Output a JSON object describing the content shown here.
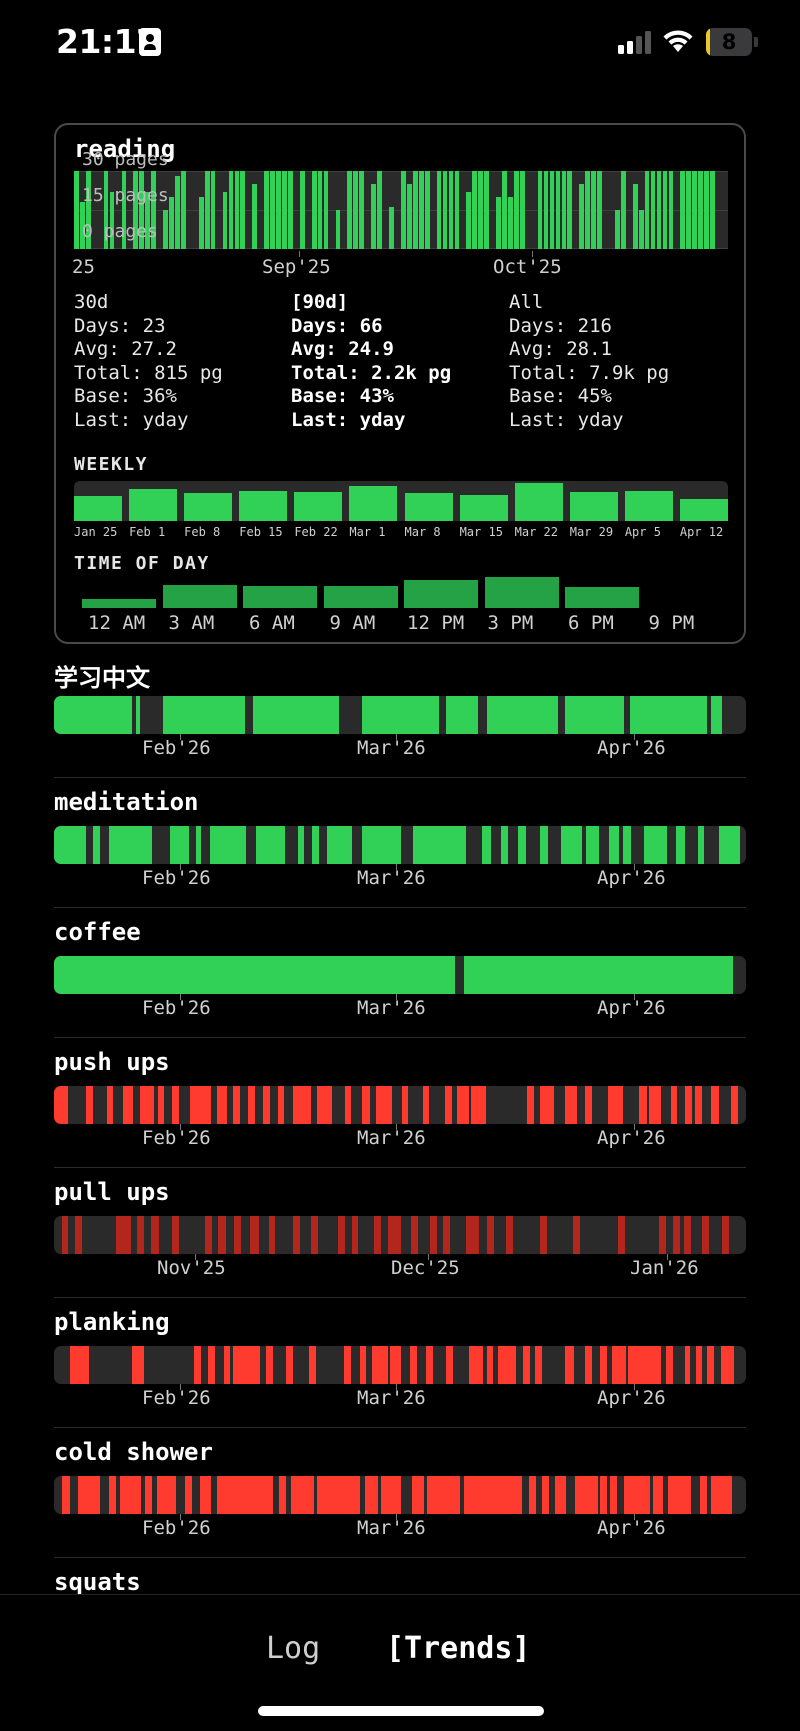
{
  "status_bar": {
    "time": "21:17",
    "battery": "8",
    "battery_level": 0.08
  },
  "reading": {
    "title": "reading",
    "y_ticks": [
      "30 pages",
      "15 pages",
      "0 pages"
    ],
    "x_ticks": [
      "25",
      "Sep'25",
      "Oct'25"
    ],
    "stats": [
      {
        "header": "30d",
        "days": "Days: 23",
        "avg": "Avg: 27.2",
        "total": "Total: 815 pg",
        "base": "Base: 36%",
        "last": "Last: yday",
        "selected": false
      },
      {
        "header": "[90d]",
        "days": "Days: 66",
        "avg": "Avg: 24.9",
        "total": "Total: 2.2k pg",
        "base": "Base: 43%",
        "last": "Last: yday",
        "selected": true
      },
      {
        "header": "All",
        "days": "Days: 216",
        "avg": "Avg: 28.1",
        "total": "Total: 7.9k pg",
        "base": "Base: 45%",
        "last": "Last: yday",
        "selected": false
      }
    ],
    "weekly_label": "WEEKLY",
    "weekly": {
      "labels": [
        "Jan 25",
        "Feb 1",
        "Feb 8",
        "Feb 15",
        "Feb 22",
        "Mar 1",
        "Mar 8",
        "Mar 15",
        "Mar 22",
        "Mar 29",
        "Apr 5",
        "Apr 12"
      ],
      "values": [
        0.62,
        0.8,
        0.7,
        0.76,
        0.72,
        0.87,
        0.7,
        0.66,
        0.95,
        0.72,
        0.75,
        0.55
      ]
    },
    "time_of_day_label": "TIME OF DAY",
    "time_of_day": {
      "labels": [
        "12 AM",
        "3 AM",
        "6 AM",
        "9 AM",
        "12 PM",
        "3 PM",
        "6 PM",
        "9 PM"
      ],
      "values": [
        0.3,
        0.75,
        0.7,
        0.72,
        0.9,
        1.0,
        0.68,
        0
      ]
    },
    "chart_data": {
      "type": "bar",
      "title": "reading",
      "ylabel_ticks": [
        "0 pages",
        "15 pages",
        "30 pages"
      ],
      "ylim": [
        0,
        30
      ],
      "x_ticks": [
        "25",
        "Sep'25",
        "Oct'25"
      ],
      "values": [
        30,
        18,
        30,
        0,
        0,
        30,
        22,
        0,
        30,
        0,
        30,
        30,
        22,
        30,
        0,
        15,
        20,
        28,
        30,
        0,
        0,
        20,
        30,
        30,
        0,
        22,
        30,
        30,
        30,
        0,
        25,
        0,
        30,
        30,
        30,
        30,
        30,
        0,
        30,
        0,
        30,
        30,
        30,
        0,
        15,
        0,
        30,
        30,
        30,
        0,
        25,
        30,
        0,
        16,
        0,
        30,
        25,
        30,
        30,
        30,
        0,
        30,
        30,
        30,
        30,
        0,
        22,
        30,
        30,
        30,
        0,
        20,
        30,
        20,
        30,
        30,
        0,
        0,
        30,
        30,
        30,
        30,
        30,
        30,
        0,
        25,
        30,
        30,
        30,
        0,
        0,
        15,
        30,
        0,
        25,
        15,
        30,
        30,
        30,
        30,
        30,
        0,
        30,
        30,
        30,
        30,
        30,
        30,
        0,
        0
      ]
    }
  },
  "habits": [
    {
      "title": "学习中文",
      "cjk": true,
      "color": "green",
      "months": [
        "Feb'26",
        "Mar'26",
        "Apr'26"
      ],
      "segments": [
        [
          0,
          11.2
        ],
        [
          11.8,
          12.4
        ],
        [
          15.7,
          25.3
        ],
        [
          22.2,
          27.6
        ],
        [
          28.8,
          41.2
        ],
        [
          44.5,
          55.7
        ],
        [
          56.7,
          61.3
        ],
        [
          62.5,
          72.8
        ],
        [
          73.8,
          82.3
        ],
        [
          83.2,
          94.3
        ],
        [
          94.9,
          96.5
        ]
      ]
    },
    {
      "title": "meditation",
      "cjk": false,
      "color": "green",
      "months": [
        "Feb'26",
        "Mar'26",
        "Apr'26"
      ],
      "segments": [
        [
          0,
          4.6
        ],
        [
          5.6,
          6.6
        ],
        [
          8.0,
          14.2
        ],
        [
          16.8,
          19.5
        ],
        [
          20.5,
          21.3
        ],
        [
          22.5,
          27.8
        ],
        [
          29.2,
          33.4
        ],
        [
          35.2,
          36.2
        ],
        [
          37.3,
          38.3
        ],
        [
          39.5,
          43.1
        ],
        [
          44.5,
          50.1
        ],
        [
          51.9,
          59.6
        ],
        [
          61.9,
          63.1
        ],
        [
          64.6,
          65.6
        ],
        [
          67.1,
          68.2
        ],
        [
          70.2,
          71.4
        ],
        [
          73.2,
          76.3
        ],
        [
          76.9,
          78.8
        ],
        [
          80.2,
          81.6
        ],
        [
          82.2,
          83.4
        ],
        [
          85.2,
          88.6
        ],
        [
          89.9,
          91.2
        ],
        [
          93.0,
          93.9
        ],
        [
          96.1,
          99.1
        ]
      ]
    },
    {
      "title": "coffee",
      "cjk": false,
      "color": "green",
      "months": [
        "Feb'26",
        "Mar'26",
        "Apr'26"
      ],
      "segments": [
        [
          0,
          58.0
        ],
        [
          59.2,
          98.1
        ]
      ]
    },
    {
      "title": "push ups",
      "cjk": false,
      "color": "red",
      "months": [
        "Feb'26",
        "Mar'26",
        "Apr'26"
      ],
      "segments": [
        [
          0,
          2.0
        ],
        [
          4.6,
          5.6
        ],
        [
          7.6,
          8.6
        ],
        [
          10.0,
          11.4
        ],
        [
          12.4,
          14.4
        ],
        [
          15.0,
          15.9
        ],
        [
          17.0,
          18.0
        ],
        [
          19.7,
          22.7
        ],
        [
          23.5,
          25.0
        ],
        [
          25.9,
          26.9
        ],
        [
          28.0,
          29.0
        ],
        [
          30.2,
          31.2
        ],
        [
          32.3,
          33.2
        ],
        [
          34.6,
          37.2
        ],
        [
          38.0,
          40.2
        ],
        [
          42.0,
          42.9
        ],
        [
          44.5,
          45.7
        ],
        [
          46.6,
          48.8
        ],
        [
          50.3,
          51.2
        ],
        [
          53.3,
          54.2
        ],
        [
          56.5,
          57.5
        ],
        [
          58.3,
          60.0
        ],
        [
          60.2,
          62.4
        ],
        [
          68.4,
          69.4
        ],
        [
          70.2,
          72.3
        ],
        [
          73.9,
          75.6
        ],
        [
          76.7,
          77.7
        ],
        [
          80.0,
          82.2
        ],
        [
          84.6,
          85.7
        ],
        [
          86.0,
          87.7
        ],
        [
          89.1,
          90.1
        ],
        [
          91.2,
          92.2
        ],
        [
          92.6,
          93.6
        ],
        [
          95.0,
          96.1
        ],
        [
          97.9,
          98.8
        ]
      ]
    },
    {
      "title": "pull ups",
      "cjk": false,
      "color": "dred",
      "months": [
        "Nov'25",
        "Dec'25",
        "Jan'26"
      ],
      "segments": [
        [
          1.1,
          2.0
        ],
        [
          3.0,
          4.0
        ],
        [
          9.0,
          11.2
        ],
        [
          12.0,
          13.0
        ],
        [
          14.0,
          15.2
        ],
        [
          17.0,
          18.0
        ],
        [
          21.8,
          22.8
        ],
        [
          23.7,
          24.9
        ],
        [
          26.0,
          27.0
        ],
        [
          28.3,
          29.6
        ],
        [
          31.0,
          32.0
        ],
        [
          34.5,
          35.5
        ],
        [
          37.2,
          38.2
        ],
        [
          41.0,
          42.0
        ],
        [
          43.0,
          44.0
        ],
        [
          46.2,
          47.2
        ],
        [
          48.2,
          50.2
        ],
        [
          51.6,
          52.6
        ],
        [
          54.3,
          55.3
        ],
        [
          56.2,
          57.2
        ],
        [
          59.6,
          61.4
        ],
        [
          62.6,
          63.6
        ],
        [
          65.3,
          66.3
        ],
        [
          70.2,
          71.2
        ],
        [
          75.0,
          76.0
        ],
        [
          81.5,
          82.5
        ],
        [
          87.4,
          88.4
        ],
        [
          89.5,
          90.5
        ],
        [
          91.1,
          92.1
        ],
        [
          93.7,
          94.7
        ],
        [
          96.5,
          97.5
        ]
      ]
    },
    {
      "title": "planking",
      "cjk": false,
      "color": "red",
      "months": [
        "Feb'26",
        "Mar'26",
        "Apr'26"
      ],
      "segments": [
        [
          2.3,
          5.1
        ],
        [
          11.2,
          13.0
        ],
        [
          20.2,
          21.3
        ],
        [
          22.2,
          23.2
        ],
        [
          24.5,
          25.5
        ],
        [
          25.9,
          29.8
        ],
        [
          30.6,
          31.6
        ],
        [
          33.5,
          34.5
        ],
        [
          36.9,
          37.9
        ],
        [
          41.9,
          42.9
        ],
        [
          44.2,
          45.1
        ],
        [
          46.0,
          48.3
        ],
        [
          48.6,
          50.1
        ],
        [
          51.4,
          52.4
        ],
        [
          53.7,
          54.7
        ],
        [
          56.6,
          57.6
        ],
        [
          60.0,
          62.0
        ],
        [
          62.5,
          63.5
        ],
        [
          64.2,
          66.7
        ],
        [
          67.8,
          68.8
        ],
        [
          69.5,
          70.5
        ],
        [
          73.9,
          75.2
        ],
        [
          76.7,
          77.7
        ],
        [
          78.9,
          79.9
        ],
        [
          80.7,
          82.7
        ],
        [
          82.9,
          87.7
        ],
        [
          88.4,
          89.4
        ],
        [
          91.2,
          91.9
        ],
        [
          92.8,
          93.6
        ],
        [
          94.4,
          95.4
        ],
        [
          96.4,
          98.2
        ]
      ]
    },
    {
      "title": "cold shower",
      "cjk": false,
      "color": "red",
      "months": [
        "Feb'26",
        "Mar'26",
        "Apr'26"
      ],
      "segments": [
        [
          1.1,
          2.3
        ],
        [
          3.5,
          6.7
        ],
        [
          7.9,
          9.0
        ],
        [
          9.5,
          12.6
        ],
        [
          13.2,
          14.2
        ],
        [
          14.9,
          17.7
        ],
        [
          19.0,
          20.0
        ],
        [
          21.1,
          22.7
        ],
        [
          23.6,
          31.6
        ],
        [
          32.5,
          33.5
        ],
        [
          34.3,
          37.6
        ],
        [
          38.0,
          44.2
        ],
        [
          45.0,
          46.8
        ],
        [
          47.2,
          50.2
        ],
        [
          51.8,
          53.4
        ],
        [
          53.9,
          58.6
        ],
        [
          59.2,
          67.6
        ],
        [
          68.6,
          69.6
        ],
        [
          70.5,
          71.5
        ],
        [
          72.4,
          74.0
        ],
        [
          75.3,
          78.6
        ],
        [
          78.9,
          79.9
        ],
        [
          80.3,
          81.3
        ],
        [
          82.4,
          86.1
        ],
        [
          86.6,
          88.0
        ],
        [
          88.7,
          92.0
        ],
        [
          93.4,
          94.4
        ],
        [
          94.9,
          98.0
        ]
      ]
    },
    {
      "title": "squats",
      "cjk": false,
      "color": "red",
      "months": [],
      "segments": []
    }
  ],
  "tabs": {
    "log": "Log",
    "trends": "[Trends]"
  }
}
